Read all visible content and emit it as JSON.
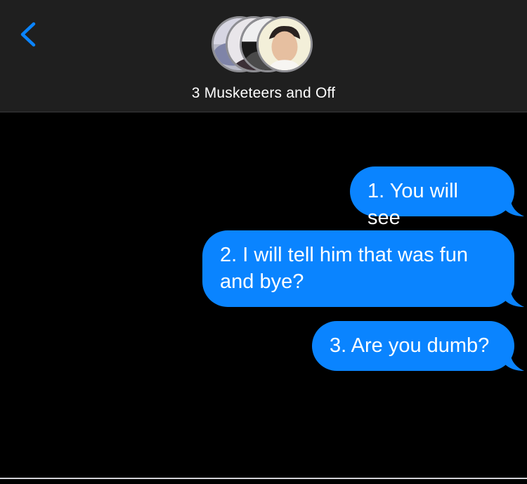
{
  "header": {
    "back_icon": "chevron-left-icon",
    "group_name": "3 Musketeers and Off",
    "avatar_count": 4
  },
  "colors": {
    "header_bg": "#1f1f1f",
    "thread_bg": "#000000",
    "accent": "#0a84ff",
    "sent_bubble": "#0a84ff",
    "text": "#ffffff"
  },
  "messages": [
    {
      "direction": "sent",
      "text": "1. You will see"
    },
    {
      "direction": "sent",
      "text": "2. I will tell him that was fun and bye?"
    },
    {
      "direction": "sent",
      "text": "3. Are you dumb?"
    }
  ]
}
